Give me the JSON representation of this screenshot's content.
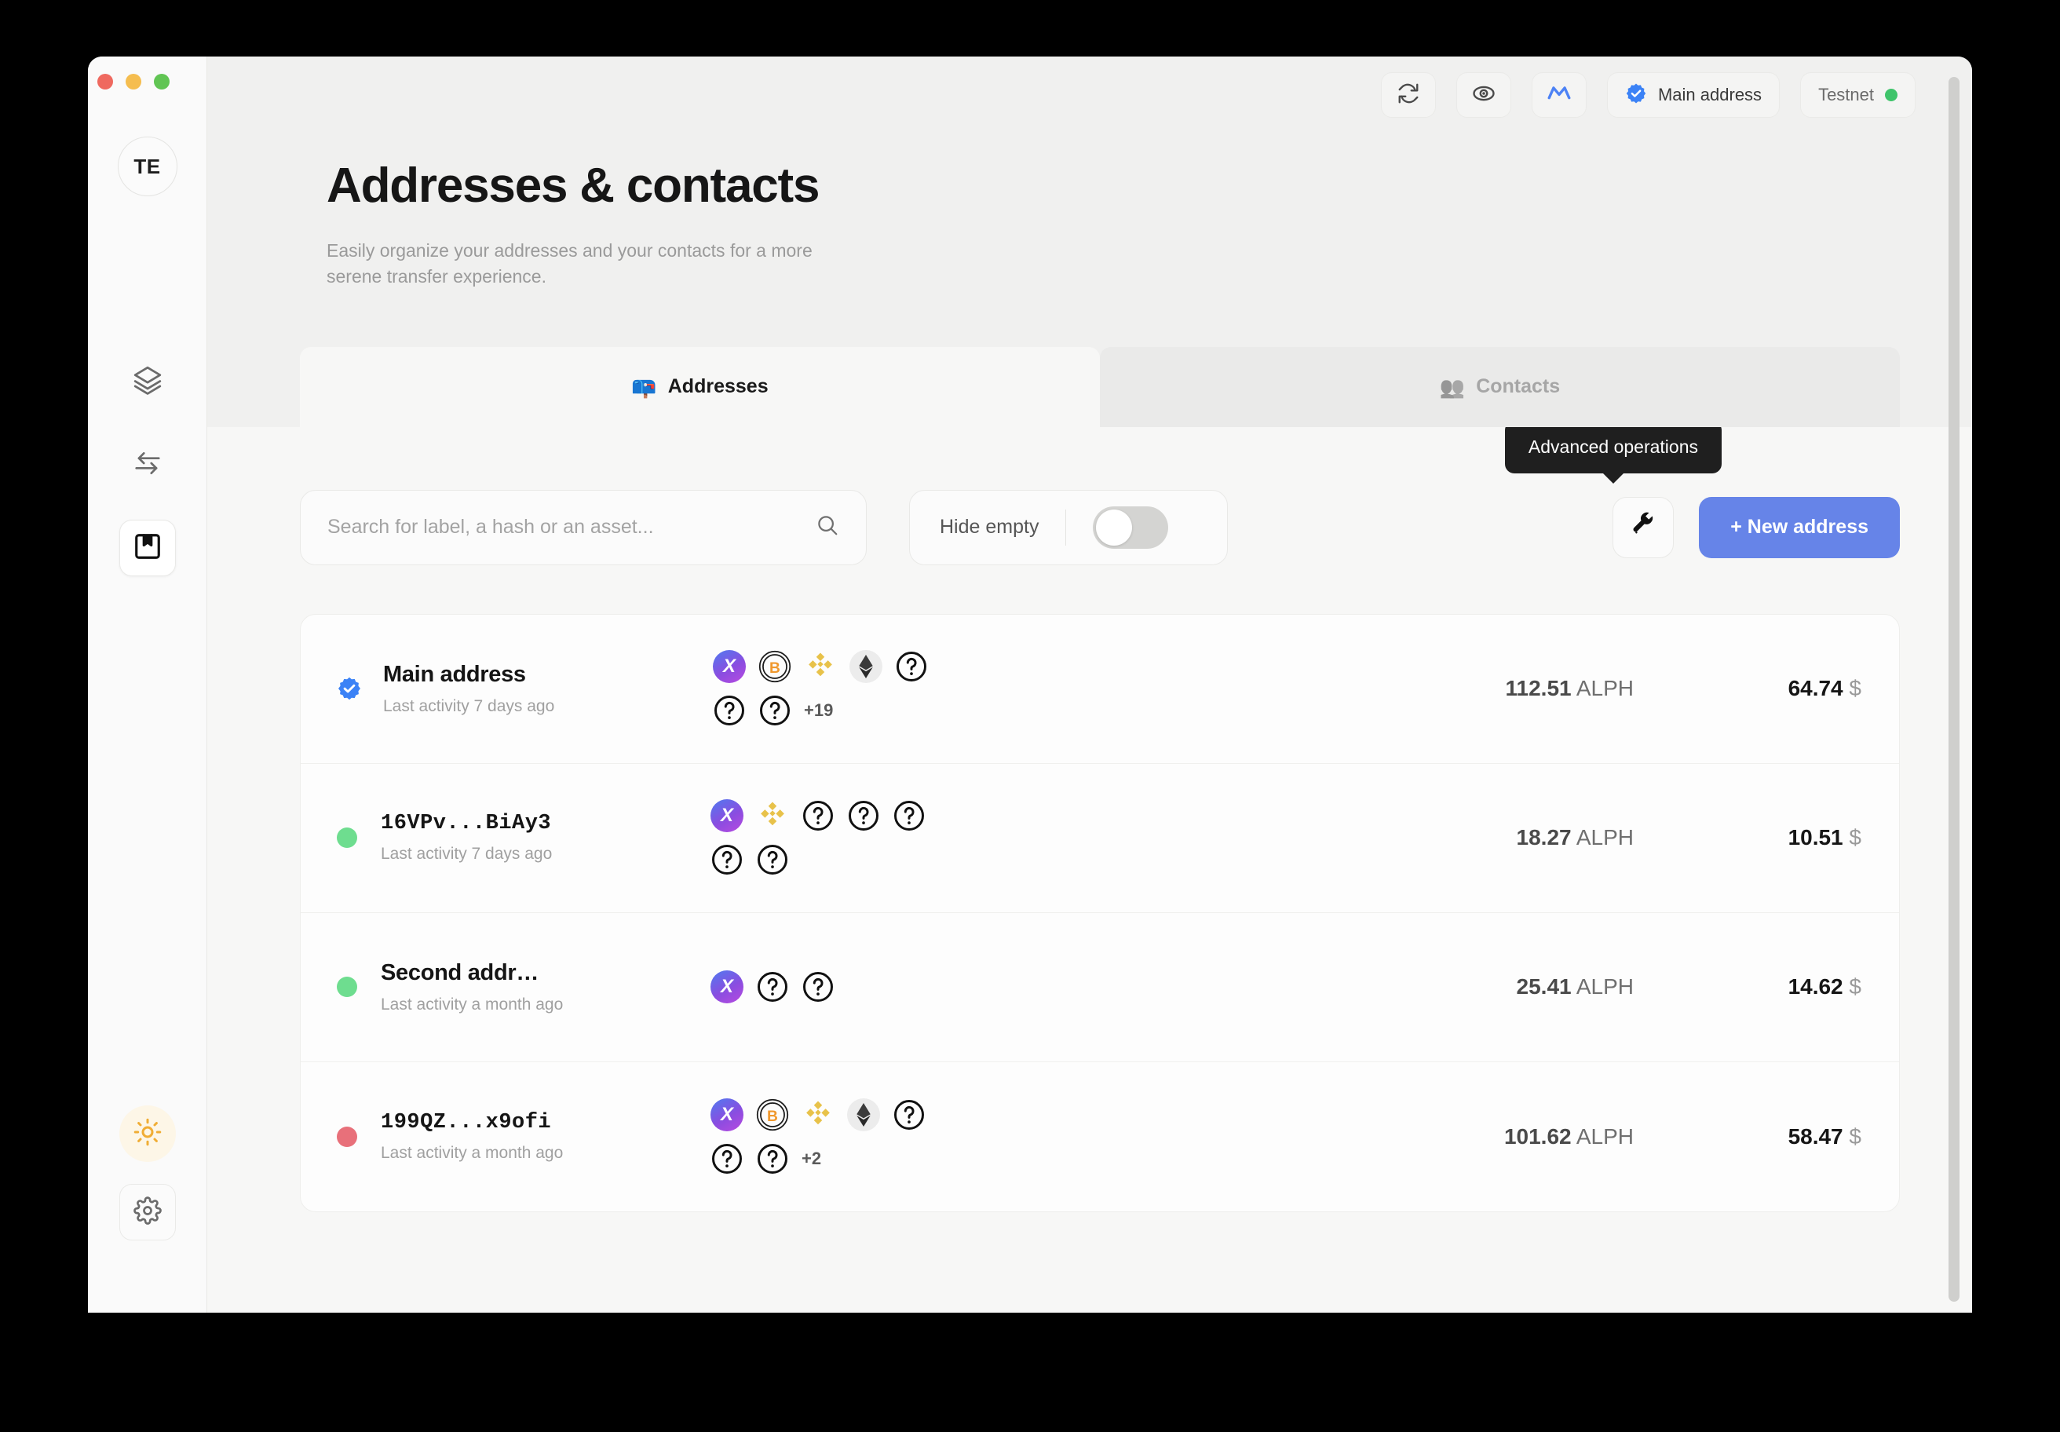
{
  "window": {
    "traffic_lights": [
      {
        "name": "close",
        "color": "#ef695f"
      },
      {
        "name": "minimize",
        "color": "#f5bd4f"
      },
      {
        "name": "maximize",
        "color": "#61c554"
      }
    ]
  },
  "sidebar": {
    "avatar_initials": "TE",
    "items": [
      {
        "name": "overview",
        "icon": "layers-icon",
        "active": false
      },
      {
        "name": "transfers",
        "icon": "transfer-arrows-icon",
        "active": false
      },
      {
        "name": "addresses",
        "icon": "address-book-icon",
        "active": true
      }
    ],
    "bottom_items": [
      {
        "name": "theme-toggle",
        "icon": "sun-icon"
      },
      {
        "name": "settings",
        "icon": "gear-icon"
      }
    ]
  },
  "topbar": {
    "refresh_icon": "refresh-icon",
    "hide_balance_icon": "eye-icon",
    "wallet_icon": "alephium-logo-icon",
    "current_address_label": "Main address",
    "current_address_icon": "verified-badge-icon",
    "network_label": "Testnet",
    "network_color": "#3fc46b"
  },
  "hero": {
    "title": "Addresses & contacts",
    "subtitle": "Easily organize your addresses and your contacts for a more serene transfer experience."
  },
  "tabs": [
    {
      "label": "Addresses",
      "emoji": "📪",
      "icon": "mailbox-icon",
      "active": true
    },
    {
      "label": "Contacts",
      "emoji": "👥",
      "icon": "contacts-icon",
      "active": false
    }
  ],
  "toolbar": {
    "search_placeholder": "Search for label, a hash or an asset...",
    "search_value": "",
    "search_icon": "search-icon",
    "hide_empty_label": "Hide empty",
    "hide_empty_on": false,
    "advanced_icon": "wrench-icon",
    "advanced_tooltip": "Advanced operations",
    "new_address_label": "+ New address",
    "new_address_color": "#6684e8"
  },
  "addresses": [
    {
      "label": "Main address",
      "label_mono": false,
      "activity": "Last activity 7 days ago",
      "status": "main",
      "status_color": "#3b82f6",
      "assets": [
        "alph",
        "btc",
        "bnb",
        "eth",
        "unknown",
        "unknown",
        "unknown"
      ],
      "assets_more": "+19",
      "amount_value": "112.51",
      "amount_unit": "ALPH",
      "fiat_value": "64.74",
      "fiat_unit": "$"
    },
    {
      "label": "16VPv...BiAy3",
      "label_mono": true,
      "activity": "Last activity 7 days ago",
      "status": "active",
      "status_color": "#6edd8f",
      "assets": [
        "alph",
        "bnb",
        "unknown",
        "unknown",
        "unknown",
        "unknown",
        "unknown"
      ],
      "assets_more": "",
      "amount_value": "18.27",
      "amount_unit": "ALPH",
      "fiat_value": "10.51",
      "fiat_unit": "$"
    },
    {
      "label": "Second addr…",
      "label_mono": false,
      "activity": "Last activity a month ago",
      "status": "active",
      "status_color": "#6edd8f",
      "assets": [
        "alph",
        "unknown",
        "unknown"
      ],
      "assets_more": "",
      "amount_value": "25.41",
      "amount_unit": "ALPH",
      "fiat_value": "14.62",
      "fiat_unit": "$"
    },
    {
      "label": "199QZ...x9ofi",
      "label_mono": true,
      "activity": "Last activity a month ago",
      "status": "inactive",
      "status_color": "#e8707a",
      "assets": [
        "alph",
        "btc",
        "bnb",
        "eth",
        "unknown",
        "unknown",
        "unknown"
      ],
      "assets_more": "+2",
      "amount_value": "101.62",
      "amount_unit": "ALPH",
      "fiat_value": "58.47",
      "fiat_unit": "$"
    }
  ]
}
